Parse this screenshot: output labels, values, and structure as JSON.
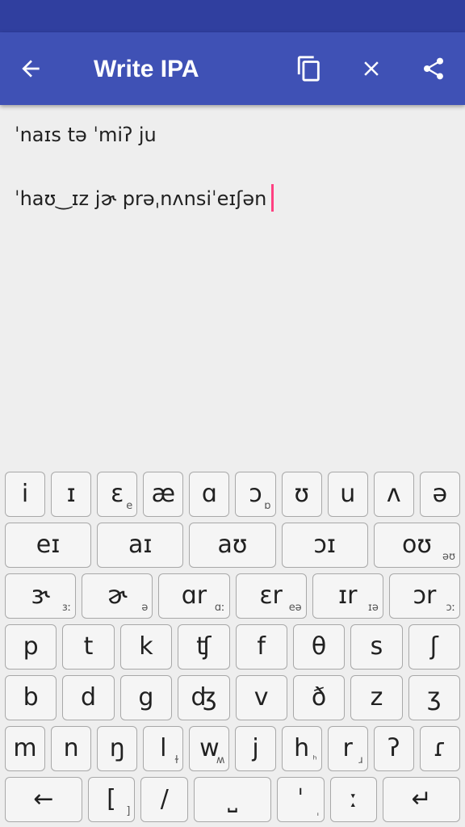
{
  "app_bar": {
    "title": "Write IPA",
    "back_icon": "arrow-back-icon",
    "copy_icon": "copy-icon",
    "close_icon": "close-icon",
    "share_icon": "share-icon",
    "background": "#3f51b5",
    "status_bar": "#303f9f"
  },
  "editor": {
    "lines": [
      "ˈnaɪs tə ˈmiʔ ju",
      "ˈhaʊ‿ɪz jɚ prəˌnʌnsiˈeɪʃən"
    ],
    "caret_color": "#ff4081"
  },
  "keyboard": {
    "rows": [
      [
        {
          "main": "i",
          "sub": ""
        },
        {
          "main": "ɪ",
          "sub": ""
        },
        {
          "main": "ɛ",
          "sub": "e"
        },
        {
          "main": "æ",
          "sub": ""
        },
        {
          "main": "ɑ",
          "sub": ""
        },
        {
          "main": "ɔ",
          "sub": "ɒ"
        },
        {
          "main": "ʊ",
          "sub": ""
        },
        {
          "main": "u",
          "sub": ""
        },
        {
          "main": "ʌ",
          "sub": ""
        },
        {
          "main": "ə",
          "sub": ""
        }
      ],
      [
        {
          "main": "eɪ",
          "sub": ""
        },
        {
          "main": "aɪ",
          "sub": ""
        },
        {
          "main": "aʊ",
          "sub": ""
        },
        {
          "main": "ɔɪ",
          "sub": ""
        },
        {
          "main": "oʊ",
          "sub": "əʊ"
        }
      ],
      [
        {
          "main": "ɝ",
          "sub": "ɜː"
        },
        {
          "main": "ɚ",
          "sub": "ə"
        },
        {
          "main": "ɑr",
          "sub": "ɑː"
        },
        {
          "main": "ɛr",
          "sub": "eə"
        },
        {
          "main": "ɪr",
          "sub": "ɪə"
        },
        {
          "main": "ɔr",
          "sub": "ɔː"
        }
      ],
      [
        {
          "main": "p",
          "sub": ""
        },
        {
          "main": "t",
          "sub": ""
        },
        {
          "main": "k",
          "sub": ""
        },
        {
          "main": "ʧ",
          "sub": ""
        },
        {
          "main": "f",
          "sub": ""
        },
        {
          "main": "θ",
          "sub": ""
        },
        {
          "main": "s",
          "sub": ""
        },
        {
          "main": "ʃ",
          "sub": ""
        }
      ],
      [
        {
          "main": "b",
          "sub": ""
        },
        {
          "main": "d",
          "sub": ""
        },
        {
          "main": "g",
          "sub": ""
        },
        {
          "main": "ʤ",
          "sub": ""
        },
        {
          "main": "v",
          "sub": ""
        },
        {
          "main": "ð",
          "sub": ""
        },
        {
          "main": "z",
          "sub": ""
        },
        {
          "main": "ʒ",
          "sub": ""
        }
      ],
      [
        {
          "main": "m",
          "sub": ""
        },
        {
          "main": "n",
          "sub": ""
        },
        {
          "main": "ŋ",
          "sub": ""
        },
        {
          "main": "l",
          "sub": "ɫ"
        },
        {
          "main": "w",
          "sub": "ʍ"
        },
        {
          "main": "j",
          "sub": ""
        },
        {
          "main": "h",
          "sub": "ʰ"
        },
        {
          "main": "r",
          "sub": "ɹ"
        },
        {
          "main": "ʔ",
          "sub": ""
        },
        {
          "main": "ɾ",
          "sub": ""
        }
      ],
      [
        {
          "main": "←",
          "sub": ""
        },
        {
          "main": "[",
          "sub": "]"
        },
        {
          "main": "/",
          "sub": ""
        },
        {
          "main": "⎵",
          "sub": ""
        },
        {
          "main": "ˈ",
          "sub": "ˌ"
        },
        {
          "main": "ː",
          "sub": ""
        },
        {
          "main": "↵",
          "sub": ""
        }
      ]
    ]
  }
}
